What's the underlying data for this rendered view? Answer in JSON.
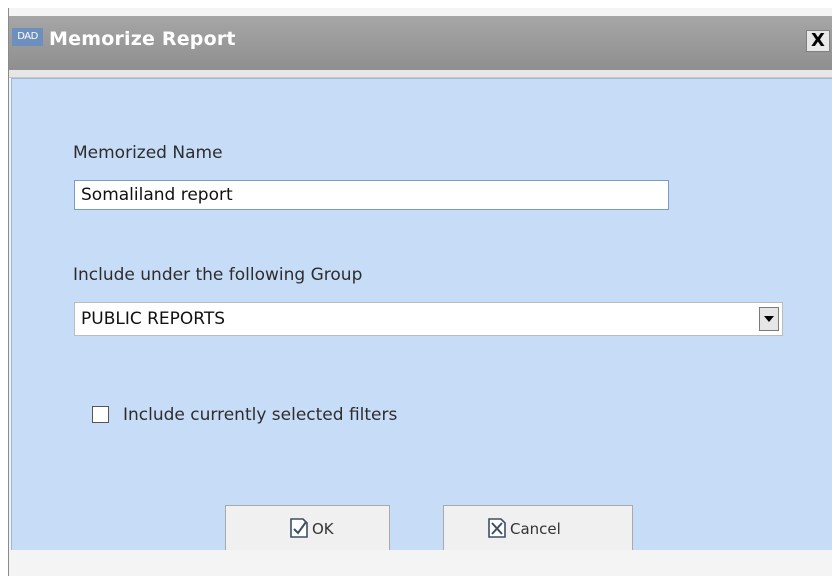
{
  "window": {
    "app_icon_text": "DAD",
    "title": "Memorize Report",
    "close_label": "X"
  },
  "form": {
    "name_label": "Memorized Name",
    "name_value": "Somaliland report",
    "group_label": "Include under the following Group",
    "group_value": "PUBLIC REPORTS",
    "filters_label": "Include currently selected filters",
    "filters_checked": false
  },
  "buttons": {
    "ok_label": "OK",
    "cancel_label": "Cancel"
  },
  "colors": {
    "titlebar": "#9a9a9a",
    "panel_background": "#c7ddf7",
    "app_icon": "#6d8fbd"
  },
  "icons": {
    "app": "dad-app-icon",
    "close": "close-icon",
    "dropdown": "chevron-down-icon",
    "ok": "check-document-icon",
    "cancel": "x-document-icon"
  }
}
